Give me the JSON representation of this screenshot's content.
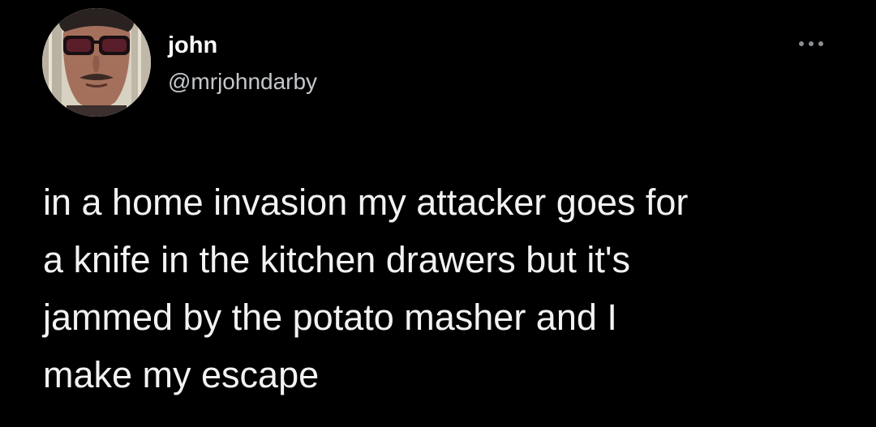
{
  "author": {
    "display_name": "john",
    "handle": "@mrjohndarby",
    "avatar_icon": "profile-photo"
  },
  "actions": {
    "more_icon": "more-horizontal-icon"
  },
  "tweet": {
    "text": "in a home invasion my attacker goes for\na knife in the kitchen drawers but it's\njammed by the potato masher and I\nmake my escape"
  },
  "colors": {
    "background": "#000000",
    "name": "#ffffff",
    "handle": "#c4c7ca",
    "text": "#f2f2f2"
  }
}
